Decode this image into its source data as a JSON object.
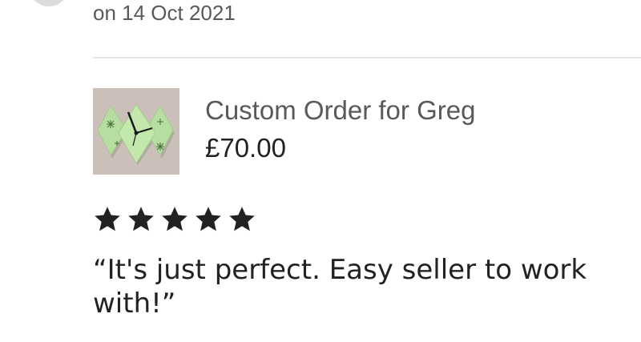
{
  "review": {
    "date": "on 14 Oct 2021",
    "rating": 5,
    "text": "“It's just perfect. Easy seller to work with!”"
  },
  "item": {
    "title": "Custom Order for Greg",
    "price": "£70.00",
    "thumbnail_icon": "green-clock-thumbnail"
  },
  "colors": {
    "muted_text": "#595959",
    "primary_text": "#222222",
    "divider": "#e3e3e3",
    "star": "#222222"
  }
}
